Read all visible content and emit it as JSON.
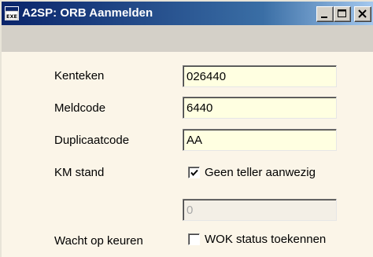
{
  "window": {
    "title": "A2SP: ORB Aanmelden",
    "icon": "exe-app-icon",
    "icon_text": "EXE"
  },
  "form": {
    "kenteken": {
      "label": "Kenteken",
      "value": "026440"
    },
    "meldcode": {
      "label": "Meldcode",
      "value": "6440"
    },
    "duplicaatcode": {
      "label": "Duplicaatcode",
      "value": "AA"
    },
    "km_stand": {
      "label": "KM stand",
      "checkbox_label": "Geen teller aanwezig",
      "checked": true,
      "value": "0",
      "disabled": true
    },
    "wacht_op_keuren": {
      "label": "Wacht op keuren",
      "checkbox_label": "WOK status toekennen",
      "checked": false
    }
  },
  "colors": {
    "title_start": "#0a246a",
    "title_end": "#a6caf0",
    "field_bg": "#ffffe1",
    "client_bg": "#fbf5e8",
    "chrome": "#d4d0c8"
  }
}
